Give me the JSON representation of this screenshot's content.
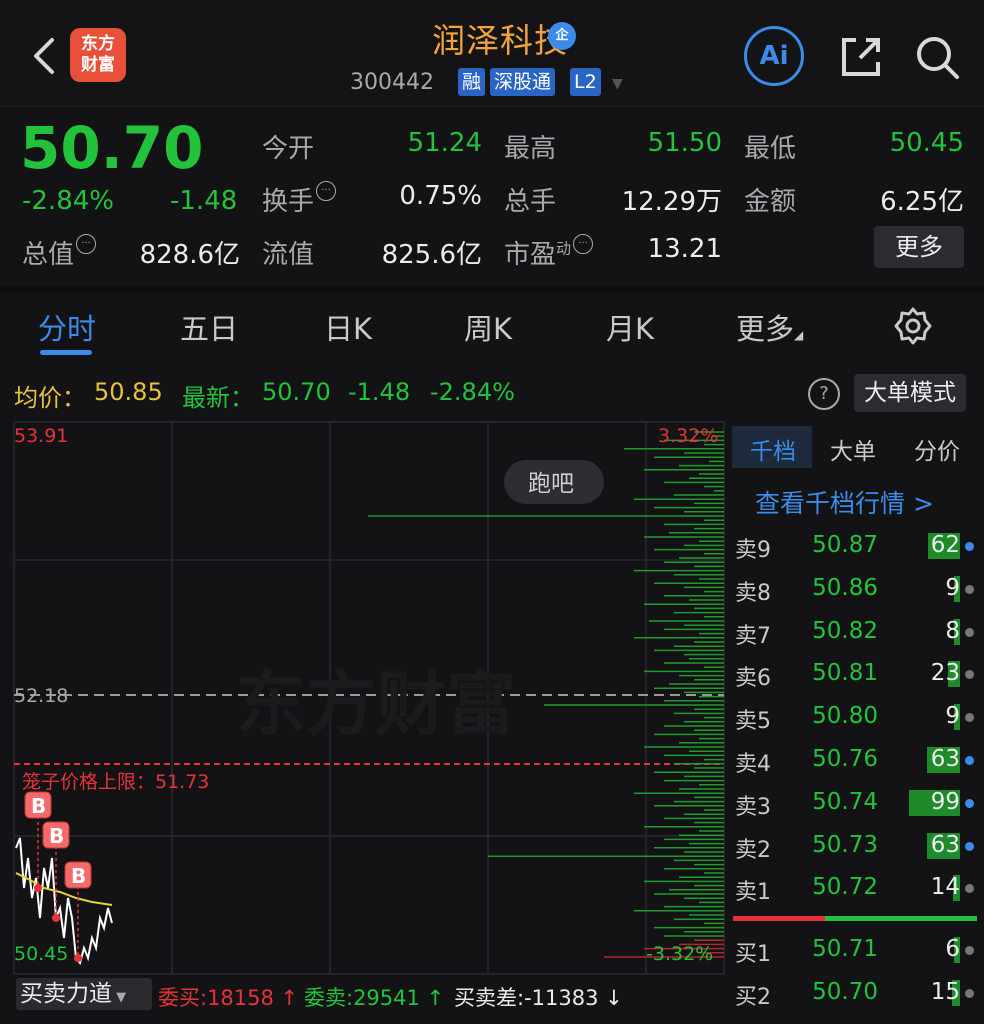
{
  "header": {
    "logo_line1": "东方",
    "logo_line2": "财富",
    "title": "润泽科技",
    "enterprise_badge": "企",
    "code": "300442",
    "tags": [
      "融",
      "深股通",
      "L2"
    ],
    "ai_label": "Ai"
  },
  "quote": {
    "price": "50.70",
    "change_pct": "-2.84%",
    "change_amt": "-1.48",
    "fields": [
      {
        "label": "今开",
        "value": "51.24",
        "color": "green"
      },
      {
        "label": "最高",
        "value": "51.50",
        "color": "green"
      },
      {
        "label": "最低",
        "value": "50.45",
        "color": "green"
      },
      {
        "label": "换手",
        "value": "0.75%",
        "color": "white"
      },
      {
        "label": "总手",
        "value": "12.29万",
        "color": "white"
      },
      {
        "label": "金额",
        "value": "6.25亿",
        "color": "white"
      },
      {
        "label": "总值",
        "value": "828.6亿",
        "color": "white"
      },
      {
        "label": "流值",
        "value": "825.6亿",
        "color": "white"
      },
      {
        "label": "市盈",
        "superscript": "动",
        "value": "13.21",
        "color": "white"
      }
    ],
    "more_label": "更多"
  },
  "tabs": [
    "分时",
    "五日",
    "日K",
    "周K",
    "月K",
    "更多"
  ],
  "active_tab": "分时",
  "info_row": {
    "avg_label": "均价：",
    "avg_value": "50.85",
    "latest_label": "最新：",
    "latest_value": "50.70",
    "latest_change": "-1.48",
    "latest_pct": "-2.84%",
    "help_glyph": "?",
    "big_order_label": "大单模式"
  },
  "chart": {
    "y_top": "53.91",
    "y_mid": "52.18",
    "y_bottom": "50.45",
    "pct_top": "3.32%",
    "pct_bottom": "-3.32%",
    "limit_label": "笼子价格上限：51.73",
    "bubble_label": "跑吧",
    "watermark": "东方财富",
    "buy_marker": "B",
    "colors": {
      "price_line": "#ffffff",
      "avg_line": "#e8d23a",
      "limit_line": "#e8323a",
      "volume_bar": "#22c33b"
    }
  },
  "orderbook": {
    "tabs": [
      "千档",
      "大单",
      "分价"
    ],
    "active_tab": "千档",
    "view_link": "查看千档行情 >",
    "asks": [
      {
        "label": "卖9",
        "price": "50.87",
        "volume": "62",
        "bar": 0.62,
        "dot": "#3b8bea"
      },
      {
        "label": "卖8",
        "price": "50.86",
        "volume": "9",
        "bar": 0.09,
        "dot": "#777777"
      },
      {
        "label": "卖7",
        "price": "50.82",
        "volume": "8",
        "bar": 0.08,
        "dot": "#777777"
      },
      {
        "label": "卖6",
        "price": "50.81",
        "volume": "23",
        "bar": 0.23,
        "dot": "#777777"
      },
      {
        "label": "卖5",
        "price": "50.80",
        "volume": "9",
        "bar": 0.09,
        "dot": "#777777"
      },
      {
        "label": "卖4",
        "price": "50.76",
        "volume": "63",
        "bar": 0.63,
        "dot": "#3b8bea"
      },
      {
        "label": "卖3",
        "price": "50.74",
        "volume": "99",
        "bar": 0.99,
        "dot": "#3b8bea"
      },
      {
        "label": "卖2",
        "price": "50.73",
        "volume": "63",
        "bar": 0.63,
        "dot": "#3b8bea"
      },
      {
        "label": "卖1",
        "price": "50.72",
        "volume": "14",
        "bar": 0.14,
        "dot": "#777777"
      }
    ],
    "bids": [
      {
        "label": "买1",
        "price": "50.71",
        "volume": "6",
        "bar": 0.06,
        "dot": "#777777"
      },
      {
        "label": "买2",
        "price": "50.70",
        "volume": "15",
        "bar": 0.15,
        "dot": "#777777"
      }
    ]
  },
  "bottom_bar": {
    "flow_select": "买卖力道",
    "entrust_buy": "委买:18158 ↑",
    "entrust_sell": "委卖:29541 ↑",
    "diff": "买卖差:-11383 ↓"
  }
}
